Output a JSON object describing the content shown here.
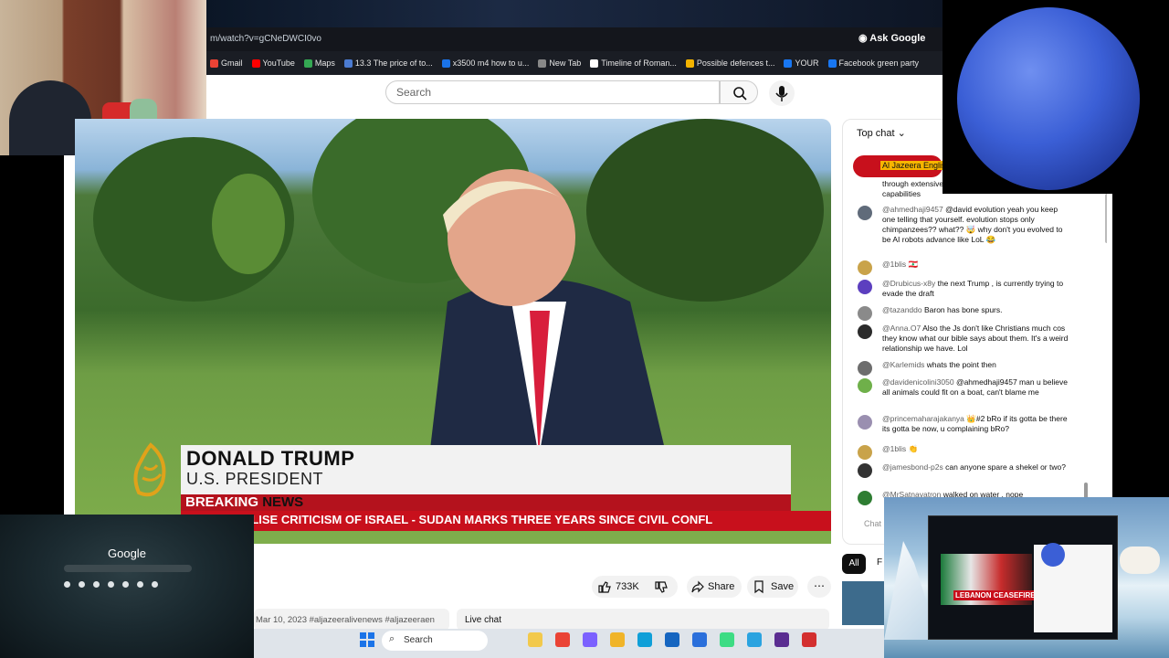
{
  "browser": {
    "url": "m/watch?v=gCNeDWCI0vo",
    "ask_google": "Ask Google",
    "bookmarks": [
      {
        "label": "Gmail",
        "color": "#ea4335"
      },
      {
        "label": "YouTube",
        "color": "#ff0000"
      },
      {
        "label": "Maps",
        "color": "#34a853"
      },
      {
        "label": "13.3 The price of to...",
        "color": "#4b7bd1"
      },
      {
        "label": "x3500 m4 how to u...",
        "color": "#1a73e8"
      },
      {
        "label": "New Tab",
        "color": "#888888"
      },
      {
        "label": "Timeline of Roman...",
        "color": "#ffffff"
      },
      {
        "label": "Possible defences t...",
        "color": "#f4b400"
      },
      {
        "label": "YOUR",
        "color": "#1877f2"
      },
      {
        "label": "Facebook green party",
        "color": "#1877f2"
      }
    ]
  },
  "youtube": {
    "search_placeholder": "Search",
    "video": {
      "name": "DONALD TRUMP",
      "role": "U.S. PRESIDENT",
      "breaking": "BREAKING",
      "news": "NEWS",
      "ticker": "O CRIMINALISE CRITICISM OF ISRAEL   -   SUDAN MARKS THREE YEARS SINCE CIVIL CONFL"
    },
    "actions": {
      "likes": "733K",
      "share": "Share",
      "save": "Save"
    },
    "description": "Mar 10, 2023  #aljazeeralivenews #aljazeeraen",
    "live_chat_button": "Live chat",
    "chips": [
      "All",
      "F"
    ],
    "chat": {
      "header": "Top chat",
      "pinned": "Al Jazeera Englis",
      "input_placeholder": "Chat",
      "messages": [
        {
          "author": "",
          "text": "through extensive ... preserve key missile and drone capabilities",
          "avatar": "#ffffff"
        },
        {
          "author": "@ahmedhaji9457",
          "text": "@david evolution yeah you keep one telling that yourself. evolution stops only chimpanzees?? what?? 🤯 why don't you evolved to be AI robots advance like LoL 😂",
          "avatar": "#606b7a"
        },
        {
          "author": "@1blis",
          "text": "🇱🇧",
          "avatar": "#c9a34a"
        },
        {
          "author": "@Drubicus-x8y",
          "text": "the next Trump , is currently trying to evade the draft",
          "avatar": "#5c3fbf"
        },
        {
          "author": "@tazanddo",
          "text": "Baron has bone spurs.",
          "avatar": "#8a8a8a"
        },
        {
          "author": "@Anna.O7",
          "text": "Also the Js don't like Christians much cos they know what our bible says about them. It's a weird relationship we have. Lol",
          "avatar": "#2b2b2b"
        },
        {
          "author": "@Karlemids",
          "text": "whats the point then",
          "avatar": "#6d6d6d"
        },
        {
          "author": "@davidenicolini3050",
          "text": "@ahmedhaji9457 man u believe all animals could fit on a boat, can't blame me",
          "avatar": "#6fb04a"
        },
        {
          "author": "@princemaharajakanya",
          "text": "👑#2  bRo if its gotta be there its gotta be now, u complaining bRo?",
          "avatar": "#9a8fb0"
        },
        {
          "author": "@1blis",
          "text": "👏",
          "avatar": "#c9a34a"
        },
        {
          "author": "@jamesbond-p2s",
          "text": "can anyone spare a shekel or two?",
          "avatar": "#333333"
        },
        {
          "author": "@MrSatnavatron",
          "text": "walked on water , nope",
          "avatar": "#2e7d32"
        }
      ]
    }
  },
  "overlays": {
    "google_title": "Google",
    "inner_label": "LEBANON CEASEFIRE"
  },
  "taskbar": {
    "search_label": "Search",
    "icons": [
      {
        "name": "file-explorer-icon",
        "color": "#f2c94c"
      },
      {
        "name": "chrome-icon",
        "color": "#ea4335"
      },
      {
        "name": "copilot-icon",
        "color": "#7b61ff"
      },
      {
        "name": "folder-icon",
        "color": "#f0b429"
      },
      {
        "name": "edge-icon",
        "color": "#0f9fd8"
      },
      {
        "name": "outlook-icon",
        "color": "#1565c0"
      },
      {
        "name": "store-icon",
        "color": "#2a6fdb"
      },
      {
        "name": "android-icon",
        "color": "#3ddc84"
      },
      {
        "name": "telegram-icon",
        "color": "#2aa3e0"
      },
      {
        "name": "purple-app-icon",
        "color": "#5a2d91"
      },
      {
        "name": "red-app-icon",
        "color": "#d32f2f"
      }
    ]
  }
}
